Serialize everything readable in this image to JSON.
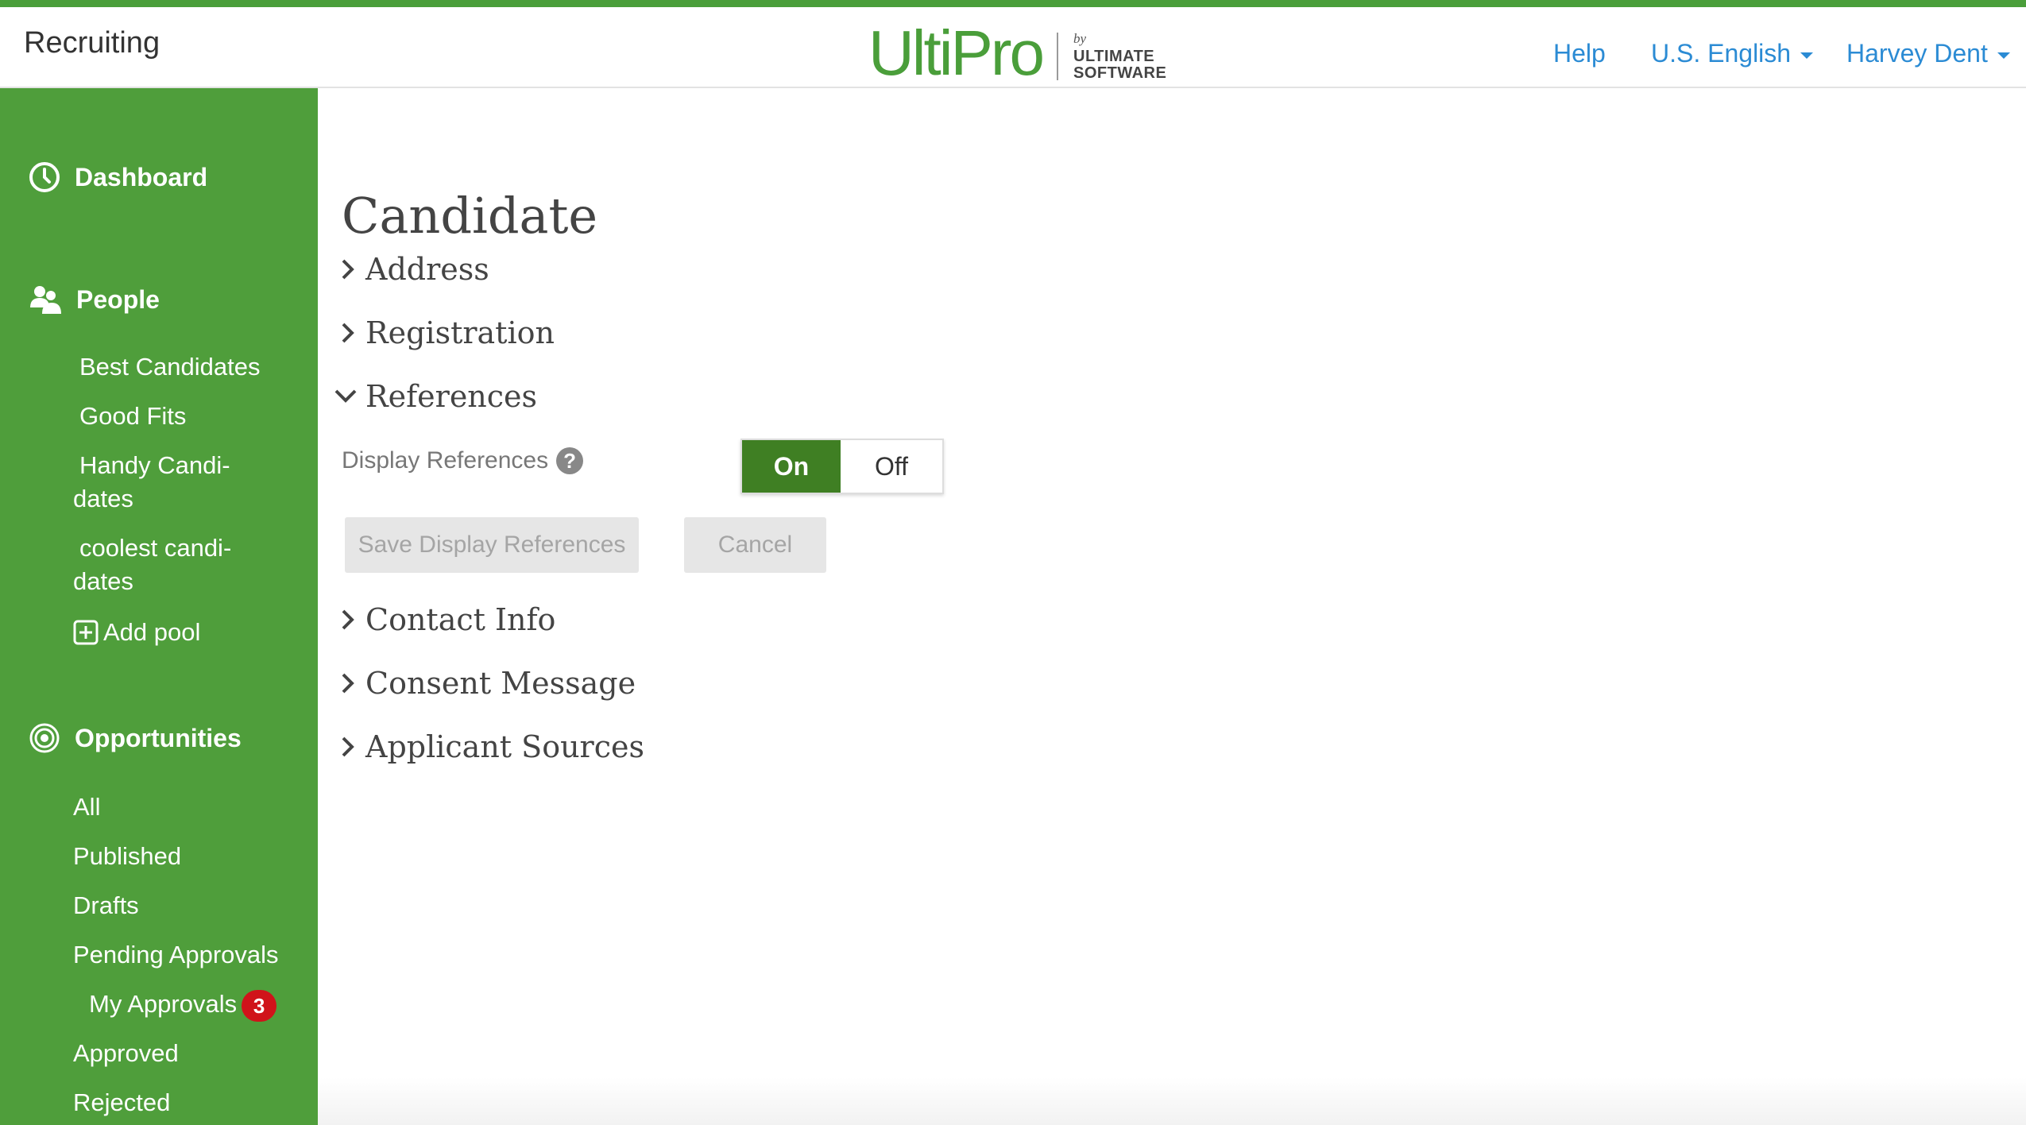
{
  "header": {
    "app_title": "Recruiting",
    "logo": {
      "word": "UltiPro",
      "by": "by",
      "company_line1": "ULTIMATE",
      "company_line2": "SOFTWARE"
    },
    "help_label": "Help",
    "language_label": "U.S. English",
    "user_label": "Harvey Dent"
  },
  "sidebar": {
    "dashboard_label": "Dashboard",
    "people_label": "People",
    "people_items": [
      {
        "label": "Best Candidates"
      },
      {
        "label": "Good Fits"
      },
      {
        "label": "Handy Candi-",
        "label2": "dates"
      },
      {
        "label": "coolest candi-",
        "label2": "dates"
      }
    ],
    "add_pool_label": "Add pool",
    "opportunities_label": "Opportunities",
    "opportunity_items": [
      {
        "label": "All"
      },
      {
        "label": "Published"
      },
      {
        "label": "Drafts"
      },
      {
        "label": "Pending Approvals"
      },
      {
        "label": "My Approvals",
        "badge": "3"
      },
      {
        "label": "Approved"
      },
      {
        "label": "Rejected"
      }
    ]
  },
  "main": {
    "page_title": "Candidate",
    "sections": [
      {
        "label": "Address",
        "expanded": false
      },
      {
        "label": "Registration",
        "expanded": false
      },
      {
        "label": "References",
        "expanded": true
      },
      {
        "label": "Contact Info",
        "expanded": false
      },
      {
        "label": "Consent Message",
        "expanded": false
      },
      {
        "label": "Applicant Sources",
        "expanded": false
      }
    ],
    "references": {
      "field_label": "Display References",
      "toggle_on_label": "On",
      "toggle_off_label": "Off",
      "toggle_value": "On",
      "save_label": "Save Display References",
      "cancel_label": "Cancel"
    }
  },
  "colors": {
    "brand_green": "#4f9e3b",
    "toggle_on_green": "#3f7f23",
    "link_blue": "#2b8bd4",
    "badge_red": "#d0131a"
  }
}
